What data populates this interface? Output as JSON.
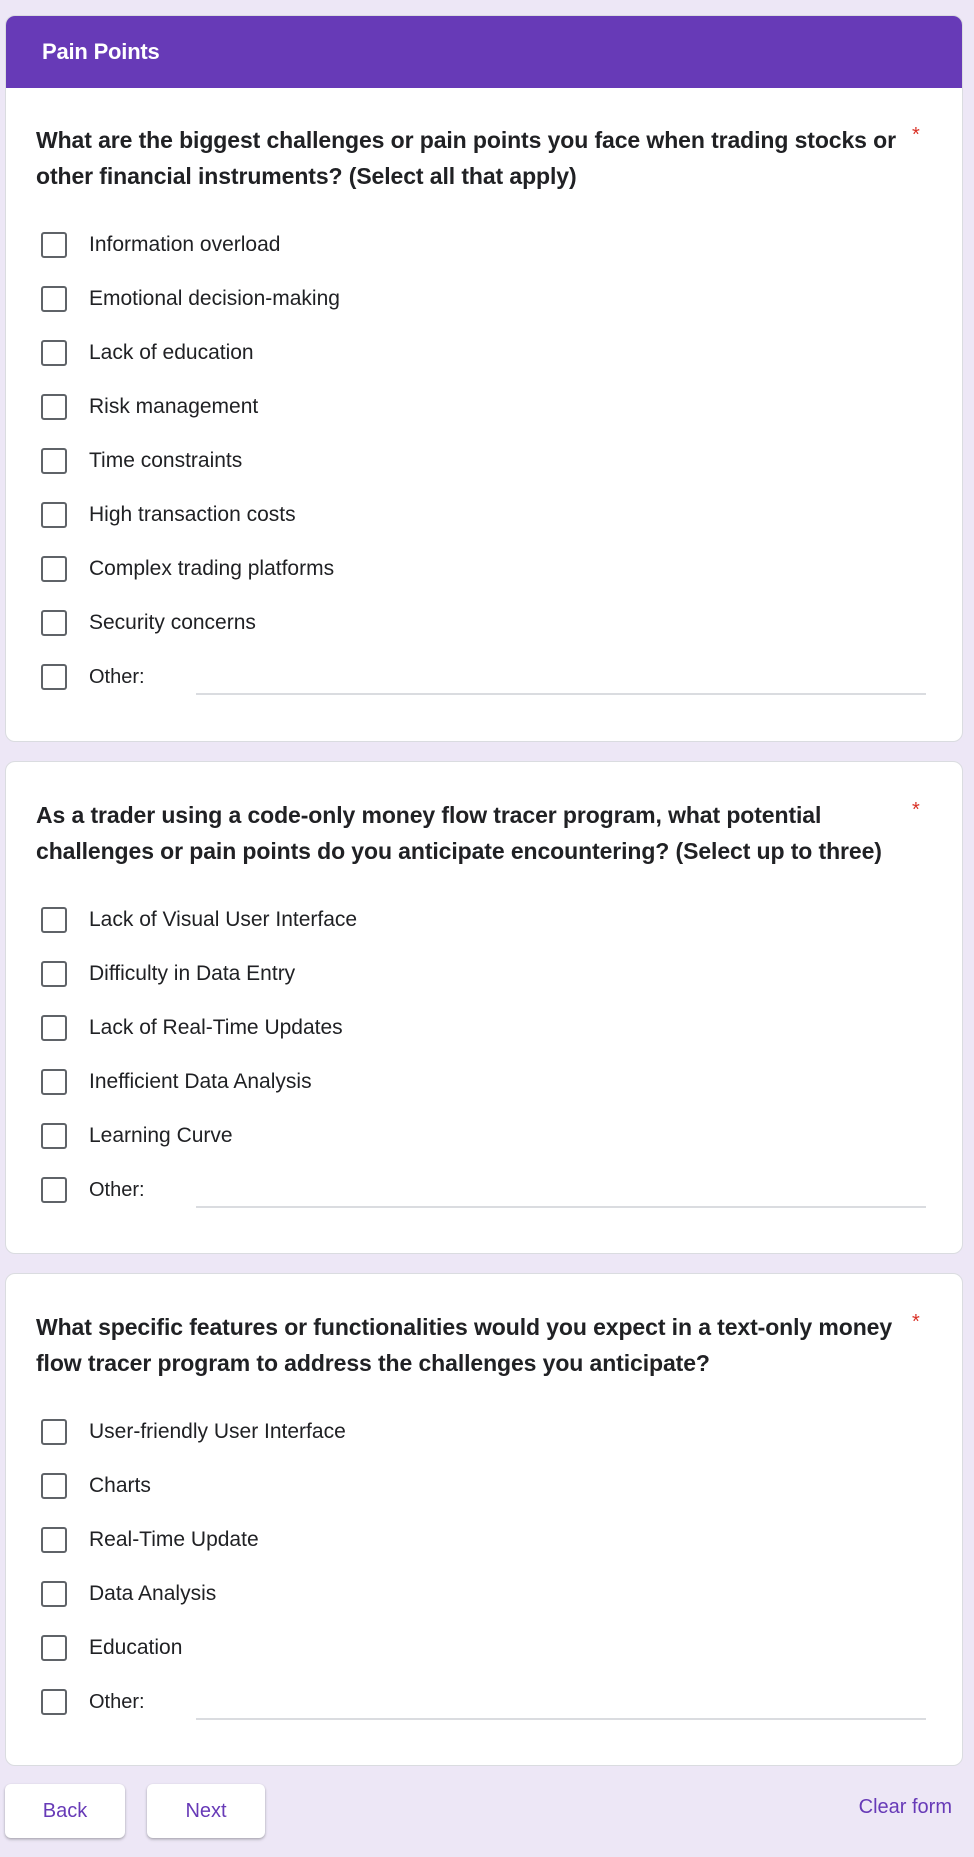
{
  "section": {
    "title": "Pain Points"
  },
  "questions": [
    {
      "text": "What are the biggest challenges or pain points you face when trading stocks or other financial instruments? (Select all that apply)",
      "required_marker": "*",
      "options": [
        "Information overload",
        "Emotional decision-making",
        "Lack of education",
        "Risk management",
        "Time constraints",
        "High transaction costs",
        "Complex trading platforms",
        "Security concerns"
      ],
      "other_label": "Other:",
      "other_value": ""
    },
    {
      "text": "As a trader using a code-only money flow tracer program, what potential challenges or pain points do you anticipate encountering? (Select up to three)",
      "required_marker": "*",
      "options": [
        "Lack of Visual User Interface",
        "Difficulty in Data Entry",
        "Lack of Real-Time Updates",
        "Inefficient Data Analysis",
        "Learning Curve"
      ],
      "other_label": "Other:",
      "other_value": ""
    },
    {
      "text": "What specific features or functionalities would you expect in a text-only money flow tracer program to address the challenges you anticipate?",
      "required_marker": "*",
      "options": [
        "User-friendly User Interface",
        "Charts",
        "Real-Time Update",
        "Data Analysis",
        "Education"
      ],
      "other_label": "Other:",
      "other_value": ""
    }
  ],
  "footer": {
    "back_label": "Back",
    "next_label": "Next",
    "clear_label": "Clear form"
  },
  "colors": {
    "accent": "#673ab7",
    "background": "#ede7f6",
    "required": "#d93025"
  }
}
